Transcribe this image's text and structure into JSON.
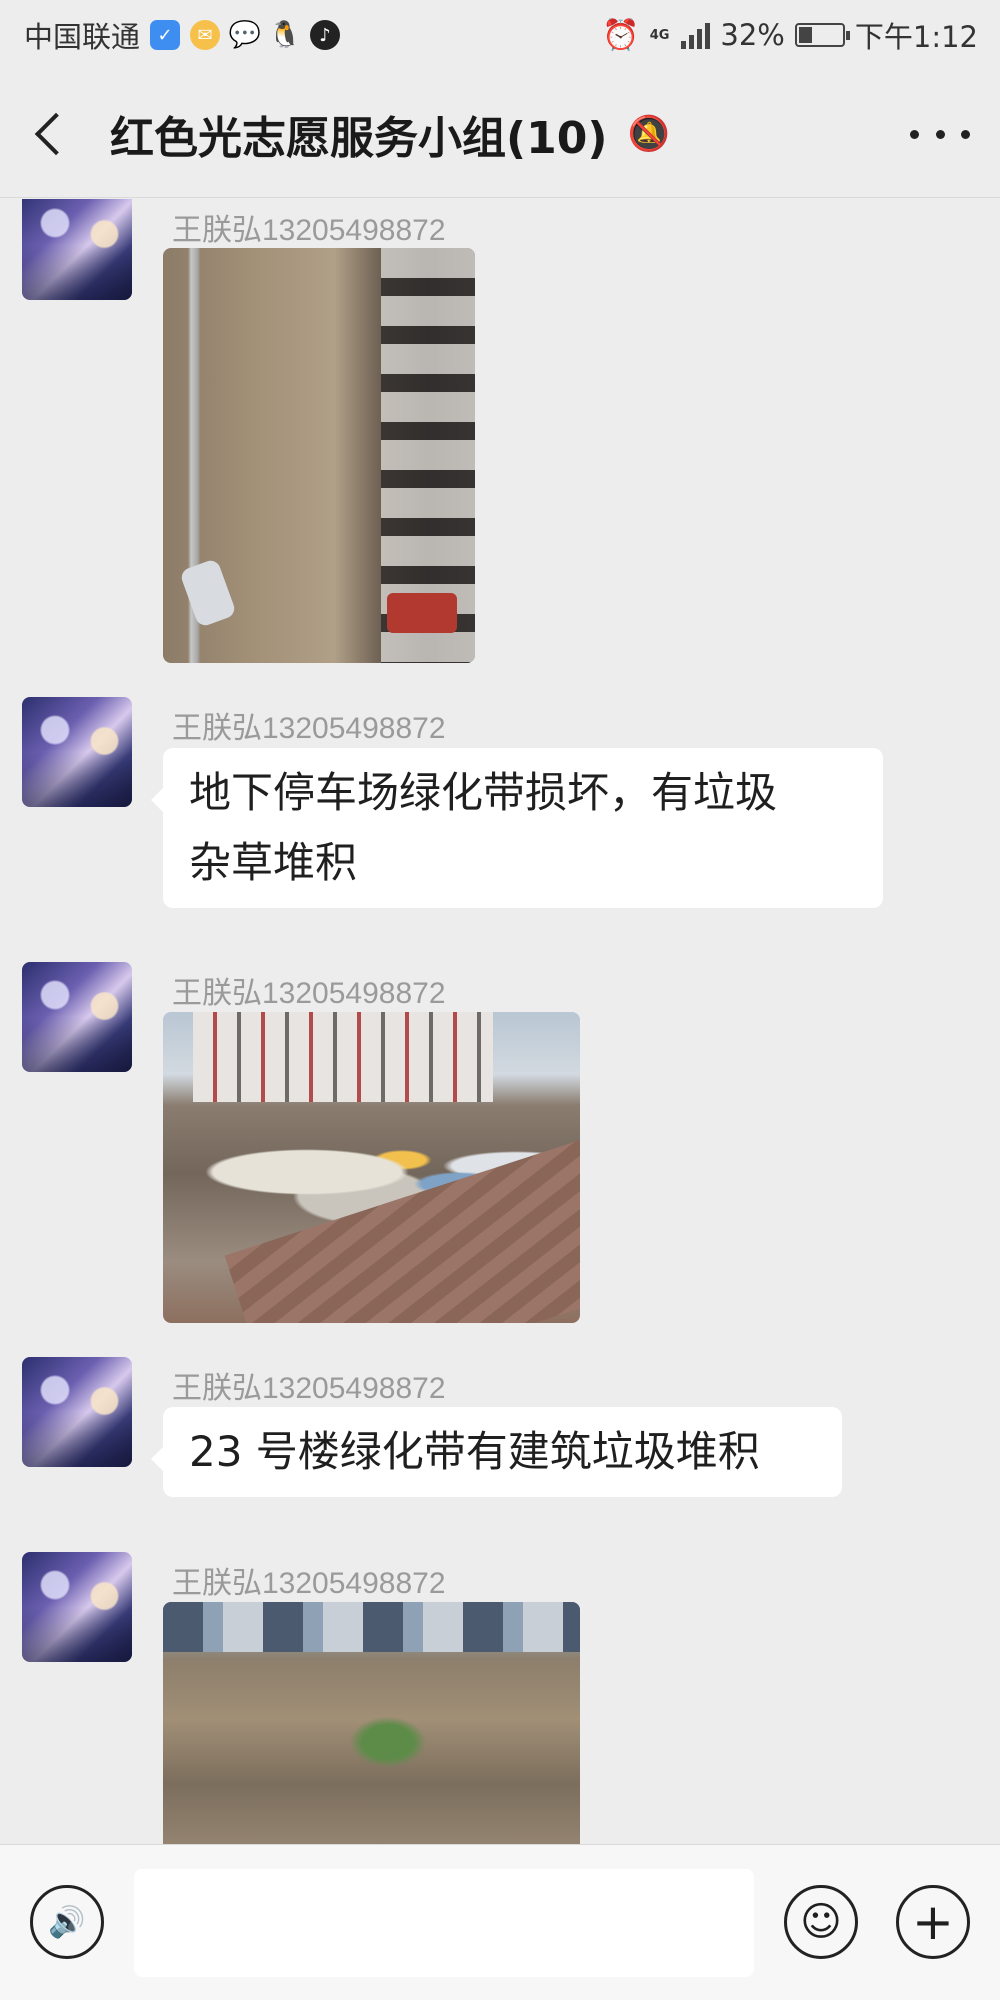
{
  "status_bar": {
    "carrier": "中国联通",
    "network": "4G",
    "battery": "32%",
    "battery_level": 0.32,
    "time": "下午1:12"
  },
  "header": {
    "title": "红色光志愿服务小组(10)"
  },
  "messages": [
    {
      "sender": "王朕弘13205498872",
      "type": "image"
    },
    {
      "sender": "王朕弘13205498872",
      "type": "text",
      "lines": [
        "地下停车场绿化带损坏，有垃圾",
        "杂草堆积"
      ]
    },
    {
      "sender": "王朕弘13205498872",
      "type": "image"
    },
    {
      "sender": "王朕弘13205498872",
      "type": "text",
      "lines": [
        "23 号楼绿化带有建筑垃圾堆积"
      ]
    },
    {
      "sender": "王朕弘13205498872",
      "type": "image"
    }
  ],
  "input": {
    "placeholder": ""
  },
  "icons": {
    "back": "back-chevron-icon",
    "mute": "bell-muted-icon",
    "more": "more-dots-icon",
    "voice": "voice-icon",
    "emoji": "emoji-icon",
    "plus": "plus-icon"
  },
  "colors": {
    "background": "#ededed",
    "bubble": "#ffffff",
    "sender_name": "#9a9a9a"
  }
}
